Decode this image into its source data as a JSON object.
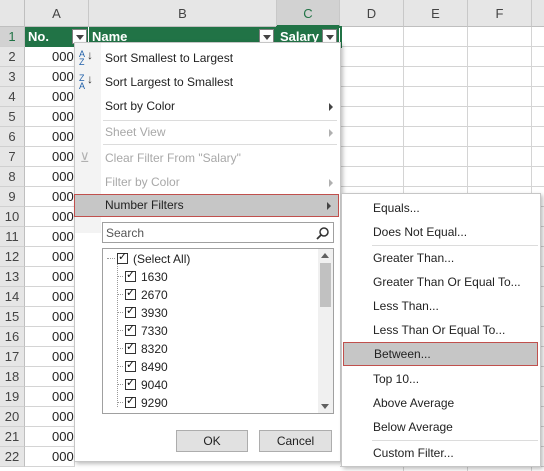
{
  "columns": [
    "A",
    "B",
    "C",
    "D",
    "E",
    "F"
  ],
  "rows": [
    "1",
    "2",
    "3",
    "4",
    "5",
    "6",
    "7",
    "8",
    "9",
    "10",
    "11",
    "12",
    "13",
    "14",
    "15",
    "16",
    "17",
    "18",
    "19",
    "20",
    "21",
    "22"
  ],
  "headers": {
    "a": "No.",
    "b": "Name",
    "c": "Salary"
  },
  "a_values": [
    "000",
    "000",
    "000",
    "000",
    "000",
    "000",
    "000",
    "000",
    "000",
    "000",
    "000",
    "000",
    "000",
    "000",
    "000",
    "000",
    "000",
    "000",
    "000",
    "000",
    "000"
  ],
  "filter_menu": {
    "sort_asc": "Sort Smallest to Largest",
    "sort_desc": "Sort Largest to Smallest",
    "sort_color": "Sort by Color",
    "sheet_view": "Sheet View",
    "clear_filter": "Clear Filter From \"Salary\"",
    "filter_color": "Filter by Color",
    "number_filters": "Number Filters",
    "search_placeholder": "Search",
    "items": [
      "(Select All)",
      "1630",
      "2670",
      "3930",
      "7330",
      "8320",
      "8490",
      "9040",
      "9290"
    ],
    "ok": "OK",
    "cancel": "Cancel"
  },
  "submenu": [
    "Equals...",
    "Does Not Equal...",
    "Greater Than...",
    "Greater Than Or Equal To...",
    "Less Than...",
    "Less Than Or Equal To...",
    "Between...",
    "Top 10...",
    "Above Average",
    "Below Average",
    "Custom Filter..."
  ],
  "colors": {
    "header_green": "#217346",
    "highlight_border": "#c0504d",
    "highlight_bg": "#c6c6c6"
  }
}
